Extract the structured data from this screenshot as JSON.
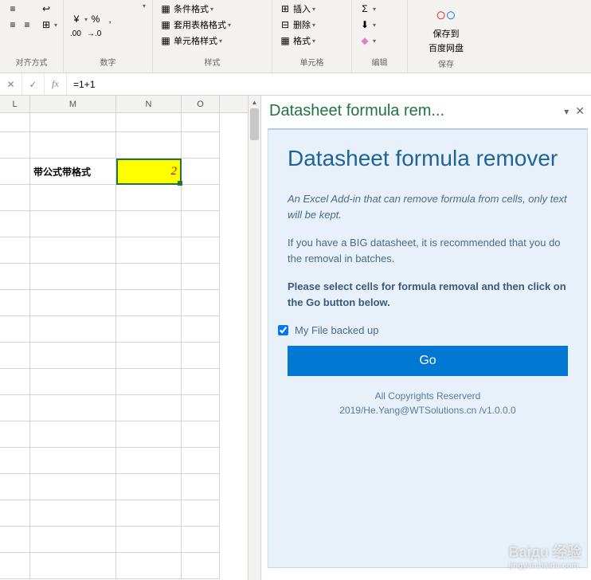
{
  "ribbon": {
    "align": {
      "title": "对齐方式",
      "indent_out": "⇤",
      "indent_in": "⇥",
      "merge": "⊞"
    },
    "number": {
      "title": "数字",
      "percent": "%",
      "comma": ",",
      "dec_inc": "←.00",
      "dec_dec": ".00→"
    },
    "styles": {
      "title": "样式",
      "cond": "条件格式",
      "table_fmt": "套用表格格式",
      "cell_style": "单元格样式"
    },
    "cells": {
      "title": "单元格",
      "insert": "插入",
      "delete": "删除",
      "format": "格式"
    },
    "editing": {
      "title": "编辑",
      "sum": "Σ",
      "fill": "⬇",
      "clear": "◇"
    },
    "save": {
      "title": "保存",
      "label1": "保存到",
      "label2": "百度网盘"
    }
  },
  "formula_bar": {
    "cancel": "✕",
    "confirm": "✓",
    "fx": "fx",
    "value": "=1+1"
  },
  "sheet": {
    "cols": [
      "L",
      "M",
      "N",
      "O"
    ],
    "row3": {
      "m": "带公式带格式",
      "n": "2"
    }
  },
  "pane": {
    "title": "Datasheet formula rem...",
    "addin_title": "Datasheet formula remover",
    "desc": "An Excel Add-in that can remove formula from cells, only text will be kept.",
    "text": "If you have a BIG datasheet, it is recommended that you do the removal in batches.",
    "bold": "Please select cells for formula removal and then click on the Go button below.",
    "checkbox": "My File backed up",
    "go": "Go",
    "copyright": "All Copyrights Reserverd",
    "footer": "2019/He.Yang@WTSolutions.cn /v1.0.0.0"
  },
  "watermark": {
    "main": "Baідu 经验",
    "sub": "jingyan.baidu.com"
  }
}
